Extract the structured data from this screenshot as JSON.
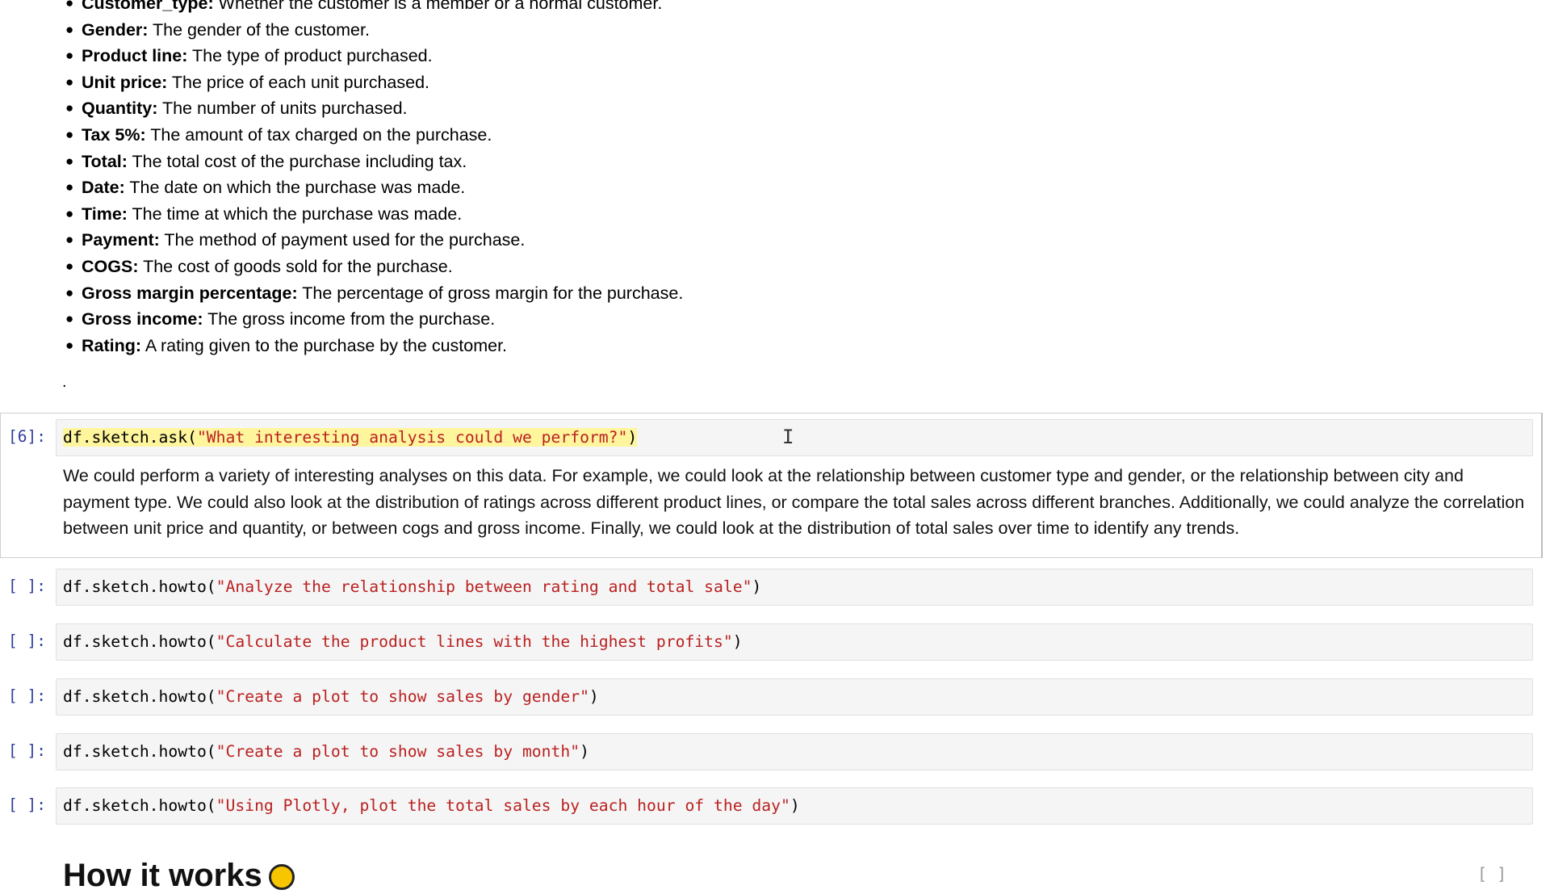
{
  "markdown": {
    "fields": [
      {
        "name": "Customer_type:",
        "desc": " Whether the customer is a member or a normal customer."
      },
      {
        "name": "Gender:",
        "desc": " The gender of the customer."
      },
      {
        "name": "Product line:",
        "desc": " The type of product purchased."
      },
      {
        "name": "Unit price:",
        "desc": " The price of each unit purchased."
      },
      {
        "name": "Quantity:",
        "desc": " The number of units purchased."
      },
      {
        "name": "Tax 5%:",
        "desc": " The amount of tax charged on the purchase."
      },
      {
        "name": "Total:",
        "desc": " The total cost of the purchase including tax."
      },
      {
        "name": "Date:",
        "desc": " The date on which the purchase was made."
      },
      {
        "name": "Time:",
        "desc": " The time at which the purchase was made."
      },
      {
        "name": "Payment:",
        "desc": " The method of payment used for the purchase."
      },
      {
        "name": "COGS:",
        "desc": " The cost of goods sold for the purchase."
      },
      {
        "name": "Gross margin percentage:",
        "desc": " The percentage of gross margin for the purchase."
      },
      {
        "name": "Gross income:",
        "desc": " The gross income from the purchase."
      },
      {
        "name": "Rating:",
        "desc": " A rating given to the purchase by the customer."
      }
    ],
    "trailing_dot": "."
  },
  "cells": [
    {
      "prompt": "[6]:",
      "code_prefix": "df.sketch.ask(",
      "code_string": "\"What interesting analysis could we perform?\"",
      "code_suffix": ")",
      "output": "We could perform a variety of interesting analyses on this data. For example, we could look at the relationship between customer type and gender, or the relationship between city and payment type. We could also look at the distribution of ratings across different product lines, or compare the total sales across different branches. Additionally, we could analyze the correlation between unit price and quantity, or between cogs and gross income. Finally, we could look at the distribution of total sales over time to identify any trends."
    },
    {
      "prompt": "[ ]:",
      "code_prefix": "df.sketch.howto(",
      "code_string": "\"Analyze the relationship between rating and total sale\"",
      "code_suffix": ")"
    },
    {
      "prompt": "[ ]:",
      "code_prefix": "df.sketch.howto(",
      "code_string": "\"Calculate the product lines with the highest profits\"",
      "code_suffix": ")"
    },
    {
      "prompt": "[ ]:",
      "code_prefix": "df.sketch.howto(",
      "code_string": "\"Create a plot to show sales by gender\"",
      "code_suffix": ")"
    },
    {
      "prompt": "[ ]:",
      "code_prefix": "df.sketch.howto(",
      "code_string": "\"Create a plot to show sales by month\"",
      "code_suffix": ")"
    },
    {
      "prompt": "[ ]:",
      "code_prefix": "df.sketch.howto(",
      "code_string": "\"Using Plotly, plot the total sales by each hour of the day\"",
      "code_suffix": ")"
    }
  ],
  "next_heading": "How it works",
  "corner_prompt": "[ ]",
  "colors": {
    "prompt": "#303f9f",
    "string": "#ba2121",
    "highlight": "#fff59d"
  }
}
